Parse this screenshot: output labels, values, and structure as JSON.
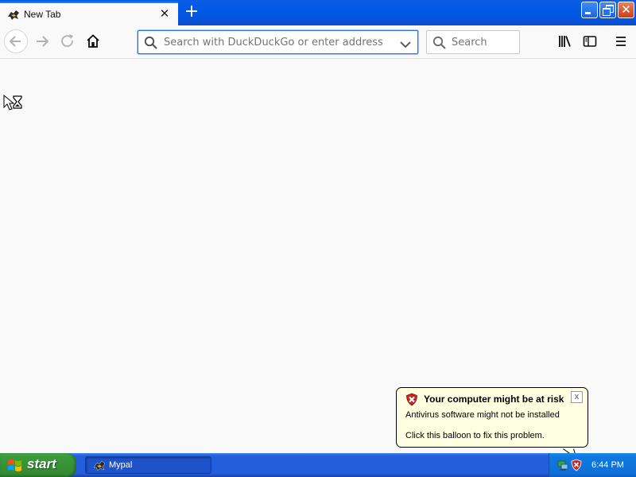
{
  "tab": {
    "title": "New Tab",
    "close_symbol": "✕"
  },
  "toolbar": {
    "new_tab_symbol": "+",
    "url_placeholder": "Search with DuckDuckGo or enter address",
    "search_placeholder": "Search"
  },
  "window_controls": {
    "close_symbol": "✕"
  },
  "icons": {
    "tab": "mypal-icon",
    "back": "back-arrow-icon",
    "forward": "forward-arrow-icon",
    "reload": "reload-icon",
    "home": "home-icon",
    "url_search": "search-icon",
    "url_dropdown": "chevron-down-icon",
    "search": "search-icon",
    "library": "library-icon",
    "sidebar": "sidebar-icon",
    "menu": "hamburger-menu-icon",
    "cursor": "busy-cursor-icon",
    "balloon_shield": "security-shield-icon",
    "tray_network": "network-tray-icon",
    "tray_security": "security-shield-icon"
  },
  "balloon": {
    "title": "Your computer might be at risk",
    "line1": "Antivirus software might not be installed",
    "line2": "Click this balloon to fix this problem.",
    "close_symbol": "x"
  },
  "taskbar": {
    "start_label": "start",
    "task_label": "Mypal",
    "clock": "6:44 PM"
  },
  "colors": {
    "titlebar": "#0058e6",
    "accent": "#0a84ff",
    "start_green": "#3c9a3c",
    "taskbar_blue": "#245edb",
    "balloon_bg": "#ffffe1"
  }
}
